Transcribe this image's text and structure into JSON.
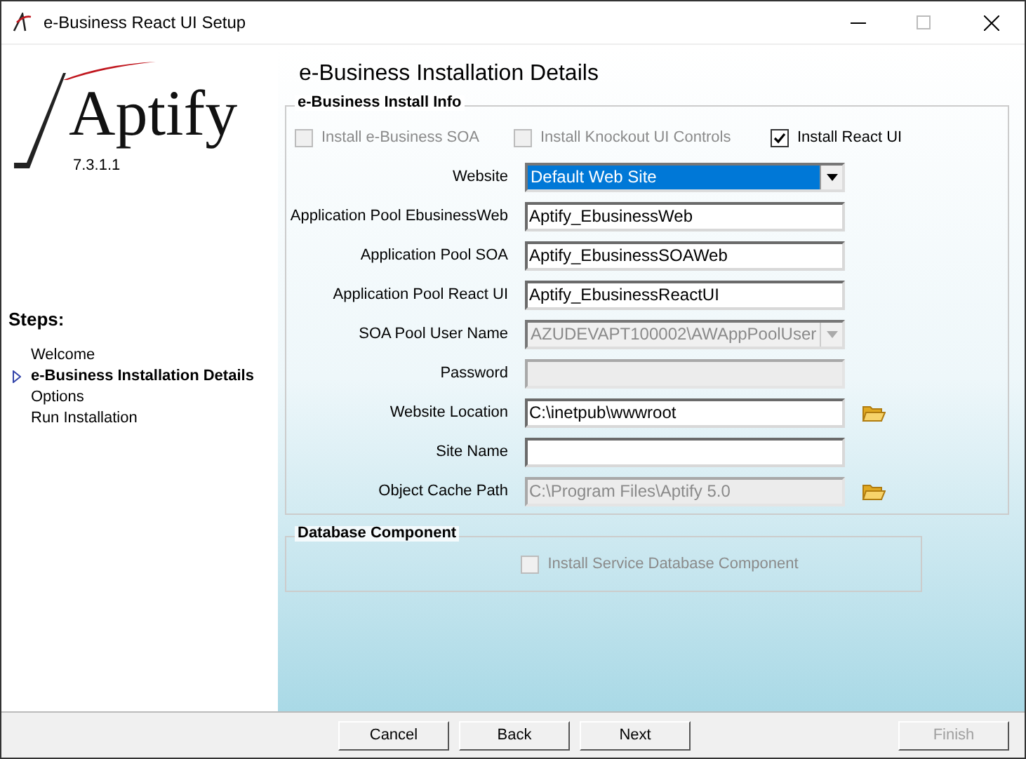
{
  "window": {
    "title": "e-Business React UI Setup"
  },
  "logo": {
    "name": "Aptify",
    "version": "7.3.1.1"
  },
  "steps": {
    "title": "Steps:",
    "items": [
      {
        "label": "Welcome",
        "selected": false
      },
      {
        "label": "e-Business Installation Details",
        "selected": true
      },
      {
        "label": "Options",
        "selected": false
      },
      {
        "label": "Run Installation",
        "selected": false
      }
    ]
  },
  "heading": "e-Business Installation Details",
  "install_info": {
    "title": "e-Business Install Info",
    "options": [
      {
        "label": "Install e-Business SOA",
        "checked": false,
        "disabled": true
      },
      {
        "label": "Install Knockout UI Controls",
        "checked": false,
        "disabled": true
      },
      {
        "label": "Install React UI",
        "checked": true,
        "disabled": false
      }
    ],
    "fields": [
      {
        "label": "Website",
        "kind": "dropdown",
        "value": "Default Web Site",
        "disabled": false,
        "selected": true,
        "browse": false
      },
      {
        "label": "Application Pool EbusinessWeb",
        "kind": "text",
        "value": "Aptify_EbusinessWeb",
        "disabled": false,
        "browse": false
      },
      {
        "label": "Application Pool SOA",
        "kind": "text",
        "value": "Aptify_EbusinessSOAWeb",
        "disabled": false,
        "browse": false
      },
      {
        "label": "Application Pool React UI",
        "kind": "text",
        "value": "Aptify_EbusinessReactUI",
        "disabled": false,
        "browse": false
      },
      {
        "label": "SOA Pool User Name",
        "kind": "dropdown",
        "value": "AZUDEVAPT100002\\AWAppPoolUser",
        "disabled": true,
        "selected": false,
        "browse": false
      },
      {
        "label": "Password",
        "kind": "text",
        "disabled": true,
        "browse": false
      },
      {
        "label": "Website Location",
        "kind": "text",
        "value": "C:\\inetpub\\wwwroot",
        "disabled": false,
        "browse": true
      },
      {
        "label": "Site Name",
        "kind": "text",
        "disabled": false,
        "browse": false
      },
      {
        "label": "Object Cache Path",
        "kind": "text",
        "value": "C:\\Program Files\\Aptify 5.0",
        "disabled": true,
        "browse": true
      }
    ]
  },
  "database": {
    "title": "Database Component",
    "option": {
      "label": "Install Service Database Component",
      "checked": false,
      "disabled": true
    }
  },
  "buttons": [
    {
      "label": "Cancel",
      "disabled": false
    },
    {
      "label": "Back",
      "disabled": false
    },
    {
      "label": "Next",
      "disabled": false
    },
    {
      "label": "Finish",
      "disabled": true
    }
  ]
}
